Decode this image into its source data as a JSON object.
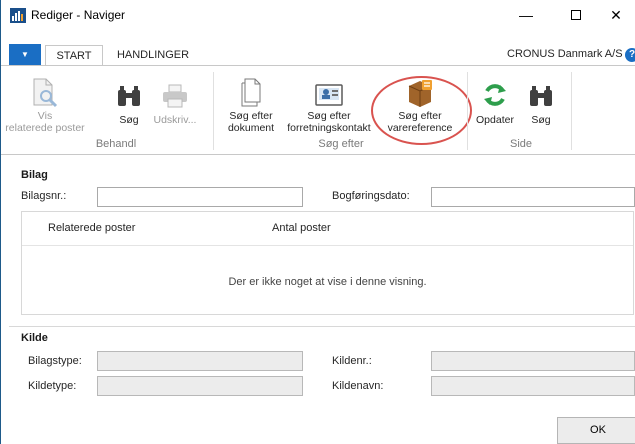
{
  "window": {
    "title": "Rediger - Naviger",
    "minimize": "—",
    "close": "✕"
  },
  "tabs": [
    {
      "label": "START",
      "active": true
    },
    {
      "label": "HANDLINGER",
      "active": false
    }
  ],
  "company": "CRONUS Danmark A/S",
  "help": "?",
  "ribbon": {
    "groups": [
      {
        "label": "Behandl"
      },
      {
        "label": "Søg efter"
      },
      {
        "label": "Side"
      }
    ],
    "buttons": {
      "related_entries": "Vis\nrelaterede poster",
      "find1": "Søg",
      "print": "Udskriv...",
      "find_document": "Søg efter\ndokument",
      "find_contact": "Søg efter\nforretningskontakt",
      "find_itemref": "Søg efter\nvarereference",
      "refresh": "Opdater",
      "find2": "Søg"
    }
  },
  "document": {
    "title": "Bilag",
    "doc_no_label": "Bilagsnr.:",
    "posting_date_label": "Bogføringsdato:",
    "doc_no_value": "",
    "posting_date_value": ""
  },
  "list": {
    "columns": [
      "Relaterede poster",
      "Antal poster"
    ],
    "empty_text": "Der er ikke noget at vise i denne visning."
  },
  "source": {
    "title": "Kilde",
    "doc_type_label": "Bilagstype:",
    "source_no_label": "Kildenr.:",
    "source_type_label": "Kildetype:",
    "source_name_label": "Kildenavn:"
  },
  "ok_button": "OK",
  "colors": {
    "accent": "#1a6ec4",
    "highlight": "#d9534f",
    "refresh_icon": "#2e9e4c"
  }
}
